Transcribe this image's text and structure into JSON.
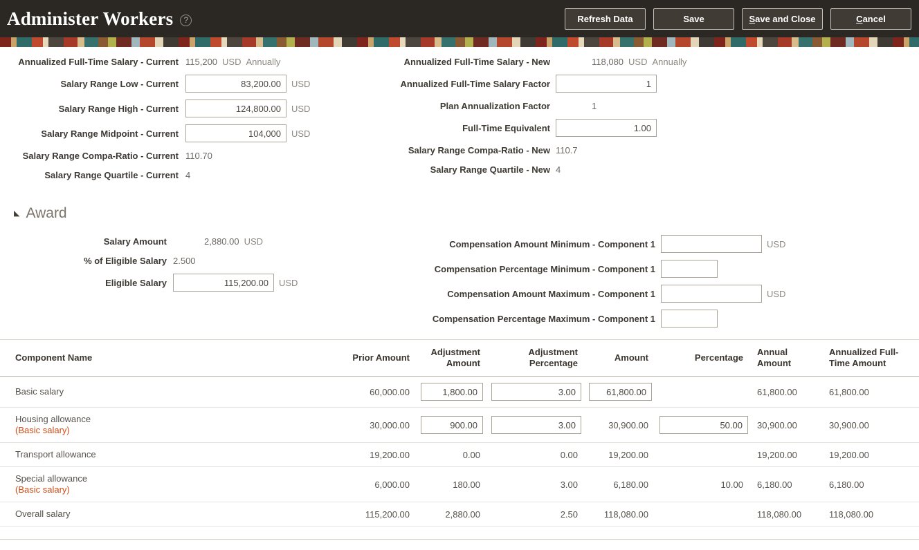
{
  "header": {
    "title": "Administer Workers",
    "help_icon": "?",
    "buttons": {
      "refresh": "Refresh Data",
      "save": "Save",
      "save_close": "Save and Close",
      "cancel": "Cancel"
    }
  },
  "salary": {
    "left": [
      {
        "label": "Annualized Full-Time Salary - Current",
        "value": "115,200",
        "currency": "USD",
        "frequency": "Annually"
      },
      {
        "label": "Salary Range Low - Current",
        "value": "83,200.00",
        "currency": "USD"
      },
      {
        "label": "Salary Range High - Current",
        "value": "124,800.00",
        "currency": "USD"
      },
      {
        "label": "Salary Range Midpoint - Current",
        "value": "104,000",
        "currency": "USD"
      },
      {
        "label": "Salary Range Compa-Ratio - Current",
        "value": "110.70"
      },
      {
        "label": "Salary Range Quartile - Current",
        "value": "4"
      }
    ],
    "right": [
      {
        "label": "Annualized Full-Time Salary - New",
        "value": "118,080",
        "currency": "USD",
        "frequency": "Annually"
      },
      {
        "label": "Annualized Full-Time Salary Factor",
        "value": "1"
      },
      {
        "label": "Plan Annualization Factor",
        "value": "1"
      },
      {
        "label": "Full-Time Equivalent",
        "value": "1.00"
      },
      {
        "label": "Salary Range Compa-Ratio - New",
        "value": "110.7"
      },
      {
        "label": "Salary Range Quartile - New",
        "value": "4"
      }
    ]
  },
  "award": {
    "title": "Award",
    "left": [
      {
        "label": "Salary Amount",
        "value": "2,880.00",
        "currency": "USD"
      },
      {
        "label": "% of Eligible Salary",
        "value": "2.500"
      },
      {
        "label": "Eligible Salary",
        "value": "115,200.00",
        "currency": "USD"
      }
    ],
    "right": [
      {
        "label": "Compensation Amount Minimum - Component 1",
        "value": "",
        "currency": "USD"
      },
      {
        "label": "Compensation Percentage Minimum - Component 1",
        "value": ""
      },
      {
        "label": "Compensation Amount Maximum - Component 1",
        "value": "",
        "currency": "USD"
      },
      {
        "label": "Compensation Percentage Maximum - Component 1",
        "value": ""
      }
    ]
  },
  "table": {
    "columns": [
      "Component Name",
      "Prior Amount",
      "Adjustment Amount",
      "Adjustment Percentage",
      "Amount",
      "Percentage",
      "Annual Amount",
      "Annualized Full-Time Amount"
    ],
    "rows": [
      {
        "name": "Basic salary",
        "sub": "",
        "prior": "60,000.00",
        "adj_amount": "1,800.00",
        "adj_pct": "3.00",
        "amount": "61,800.00",
        "pct": "",
        "annual": "61,800.00",
        "annualized": "61,800.00"
      },
      {
        "name": "Housing allowance",
        "sub": "(Basic salary)",
        "prior": "30,000.00",
        "adj_amount": "900.00",
        "adj_pct": "3.00",
        "amount": "30,900.00",
        "pct": "50.00",
        "annual": "30,900.00",
        "annualized": "30,900.00"
      },
      {
        "name": "Transport allowance",
        "sub": "",
        "prior": "19,200.00",
        "adj_amount": "0.00",
        "adj_pct": "0.00",
        "amount": "19,200.00",
        "pct": "",
        "annual": "19,200.00",
        "annualized": "19,200.00"
      },
      {
        "name": "Special allowance",
        "sub": "(Basic salary)",
        "prior": "6,000.00",
        "adj_amount": "180.00",
        "adj_pct": "3.00",
        "amount": "6,180.00",
        "pct": "10.00",
        "annual": "6,180.00",
        "annualized": "6,180.00"
      },
      {
        "name": "Overall salary",
        "sub": "",
        "prior": "115,200.00",
        "adj_amount": "2,880.00",
        "adj_pct": "2.50",
        "amount": "118,080.00",
        "pct": "",
        "annual": "118,080.00",
        "annualized": "118,080.00"
      }
    ]
  }
}
